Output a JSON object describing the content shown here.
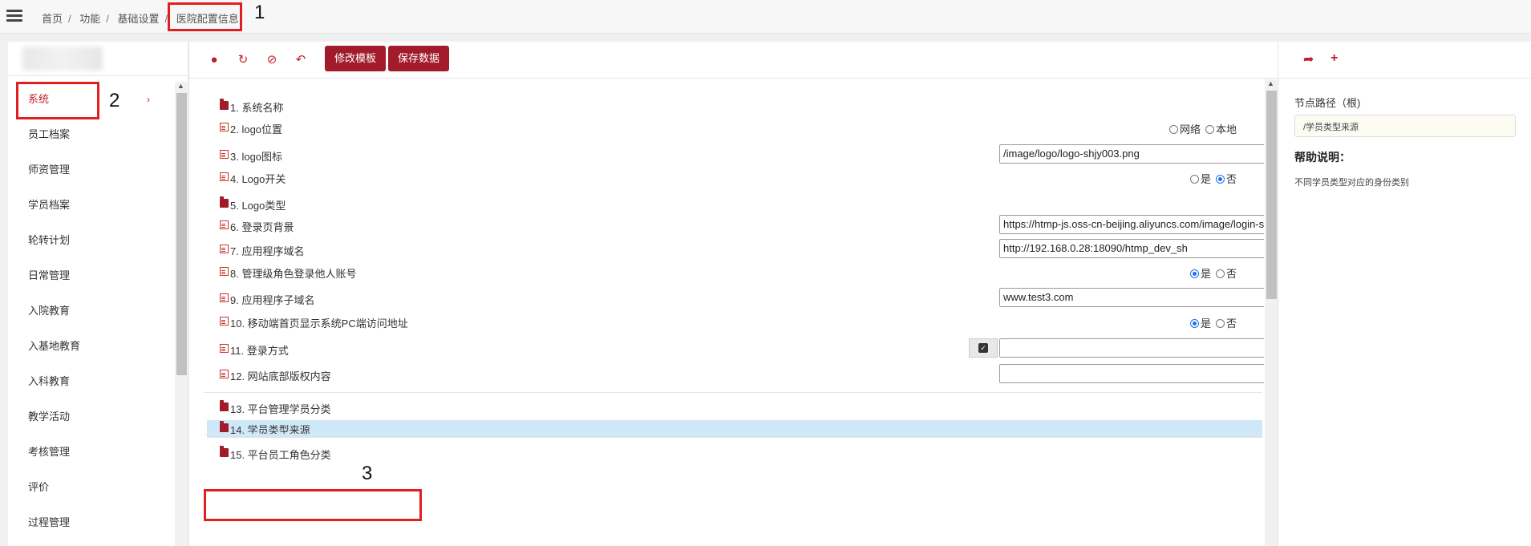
{
  "breadcrumb": [
    "首页",
    "功能",
    "基础设置",
    "医院配置信息"
  ],
  "annotations": [
    "1",
    "2",
    "3"
  ],
  "sidebar": {
    "items": [
      {
        "label": "系统",
        "active": true
      },
      {
        "label": "员工档案"
      },
      {
        "label": "师资管理"
      },
      {
        "label": "学员档案"
      },
      {
        "label": "轮转计划"
      },
      {
        "label": "日常管理"
      },
      {
        "label": "入院教育"
      },
      {
        "label": "入基地教育"
      },
      {
        "label": "入科教育"
      },
      {
        "label": "教学活动"
      },
      {
        "label": "考核管理"
      },
      {
        "label": "评价"
      },
      {
        "label": "过程管理"
      }
    ],
    "chevron": "›"
  },
  "toolbar": {
    "icons": [
      "lightbulb-icon",
      "refresh-icon",
      "eye-slash-icon",
      "undo-icon"
    ],
    "modify_template": "修改模板",
    "save_data": "保存数据"
  },
  "tree": {
    "items": [
      {
        "label": "1. 系统名称",
        "kind": "folder"
      },
      {
        "label": "2. logo位置",
        "kind": "file",
        "radio": [
          "网络",
          "本地"
        ],
        "selected": -1
      },
      {
        "label": "3. logo图标",
        "kind": "file",
        "value": "/image/logo/logo-shjy003.png"
      },
      {
        "label": "4. Logo开关",
        "kind": "file",
        "radio": [
          "是",
          "否"
        ],
        "selected": 1
      },
      {
        "label": "5. Logo类型",
        "kind": "folder"
      },
      {
        "label": "6. 登录页背景",
        "kind": "file",
        "value": "https://htmp-js.oss-cn-beijing.aliyuncs.com/image/login-sh"
      },
      {
        "label": "7. 应用程序域名",
        "kind": "file",
        "value": "http://192.168.0.28:18090/htmp_dev_sh"
      },
      {
        "label": "8. 管理级角色登录他人账号",
        "kind": "file",
        "radio": [
          "是",
          "否"
        ],
        "selected": 0
      },
      {
        "label": "9. 应用程序子域名",
        "kind": "file",
        "value": "www.test3.com"
      },
      {
        "label": "10. 移动端首页显示系统PC端访问地址",
        "kind": "file",
        "radio": [
          "是",
          "否"
        ],
        "selected": 0
      },
      {
        "label": "11. 登录方式",
        "kind": "file",
        "value": "",
        "checkbox": true
      },
      {
        "label": "12. 网站底部版权内容",
        "kind": "file",
        "value": ""
      },
      {
        "label": "13. 平台管理学员分类",
        "kind": "folder"
      },
      {
        "label": "14. 学员类型来源",
        "kind": "folder",
        "highlighted": true
      },
      {
        "label": "15. 平台员工角色分类",
        "kind": "folder"
      }
    ]
  },
  "right_panel": {
    "icons": [
      "redo-icon",
      "plus-icon"
    ],
    "path_label": "节点路径（根)",
    "path_value": "/学员类型来源",
    "help_title": "帮助说明：",
    "help_text": "不同学员类型对应的身份类别"
  }
}
